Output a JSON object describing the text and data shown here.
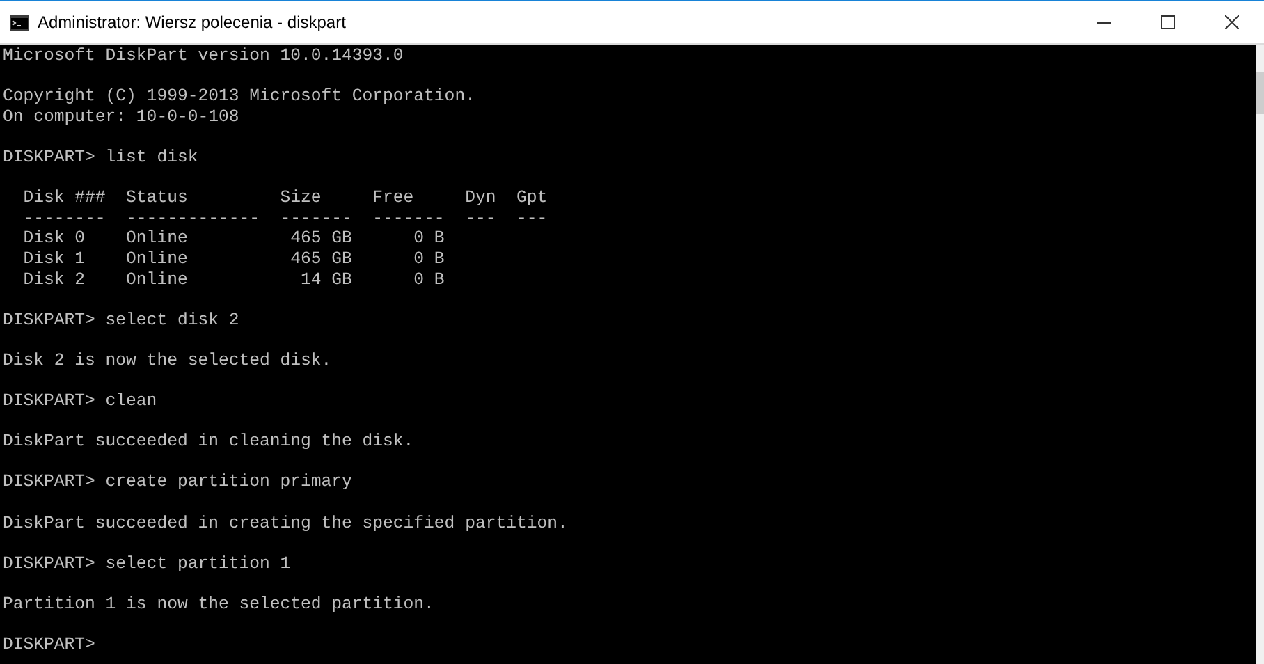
{
  "window": {
    "title": "Administrator: Wiersz polecenia - diskpart"
  },
  "console": {
    "blocks": [
      [
        "Microsoft DiskPart version 10.0.14393.0"
      ],
      [
        "Copyright (C) 1999-2013 Microsoft Corporation.",
        "On computer: 10-0-0-108"
      ],
      [
        "DISKPART> list disk"
      ],
      [
        "  Disk ###  Status         Size     Free     Dyn  Gpt",
        "  --------  -------------  -------  -------  ---  ---",
        "  Disk 0    Online          465 GB      0 B",
        "  Disk 1    Online          465 GB      0 B",
        "  Disk 2    Online           14 GB      0 B"
      ],
      [
        "DISKPART> select disk 2"
      ],
      [
        "Disk 2 is now the selected disk."
      ],
      [
        "DISKPART> clean"
      ],
      [
        "DiskPart succeeded in cleaning the disk."
      ],
      [
        "DISKPART> create partition primary"
      ],
      [
        "DiskPart succeeded in creating the specified partition."
      ],
      [
        "DISKPART> select partition 1"
      ],
      [
        "Partition 1 is now the selected partition."
      ],
      [
        "DISKPART>"
      ]
    ]
  }
}
